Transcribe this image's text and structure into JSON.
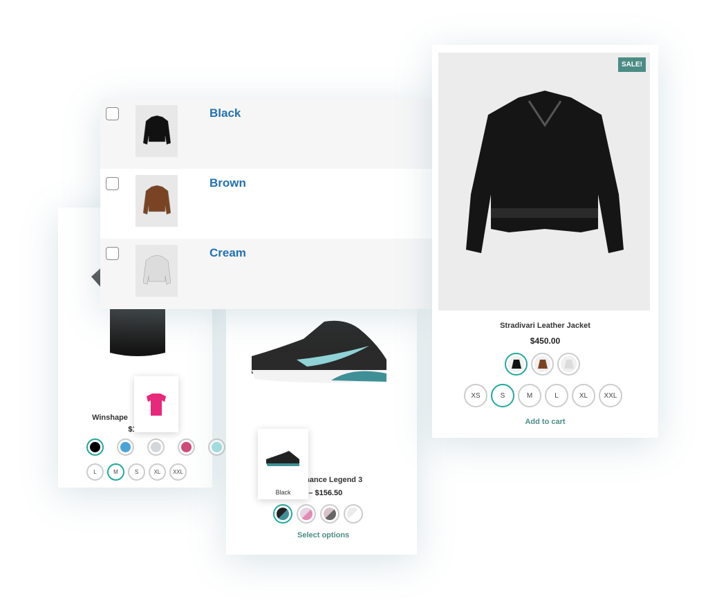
{
  "left_card": {
    "title": "Winshape",
    "price": "$1",
    "colors": [
      "#000000",
      "#4aa3d6",
      "#d3d6da",
      "#d04a78",
      "#a7e3e3"
    ],
    "selected_color": 0,
    "sizes": [
      "L",
      "M",
      "S",
      "XL",
      "XXL"
    ],
    "selected_size": 1,
    "tooltip_color": "#e8287a"
  },
  "middle_card": {
    "title": "ormance Legend 3",
    "price": "99 – $156.50",
    "tooltip_label": "Black",
    "swatches": [
      [
        "#222222",
        "#3f8f96"
      ],
      [
        "#e4d6e4",
        "#e48ab4"
      ],
      [
        "#d7c3c8",
        "#666666"
      ],
      [
        "#ececec",
        "#ffffff"
      ]
    ],
    "selected_swatch": 0,
    "link": "Select options"
  },
  "variation_table": {
    "rows": [
      {
        "label": "Black",
        "jacket_color": "#111111"
      },
      {
        "label": "Brown",
        "jacket_color": "#7a4424"
      },
      {
        "label": "Cream",
        "jacket_color": "#dcdcdc"
      }
    ]
  },
  "right_card": {
    "badge": "SALE!",
    "title": "Stradivari Leather Jacket",
    "price": "$450.00",
    "color_swatches": [
      "#111111",
      "#7a4424",
      "#dcdcdc"
    ],
    "selected_color": 0,
    "sizes": [
      "XS",
      "S",
      "M",
      "L",
      "XL",
      "XXL"
    ],
    "selected_size": 1,
    "link": "Add to cart",
    "accent": "#4b8c84"
  }
}
